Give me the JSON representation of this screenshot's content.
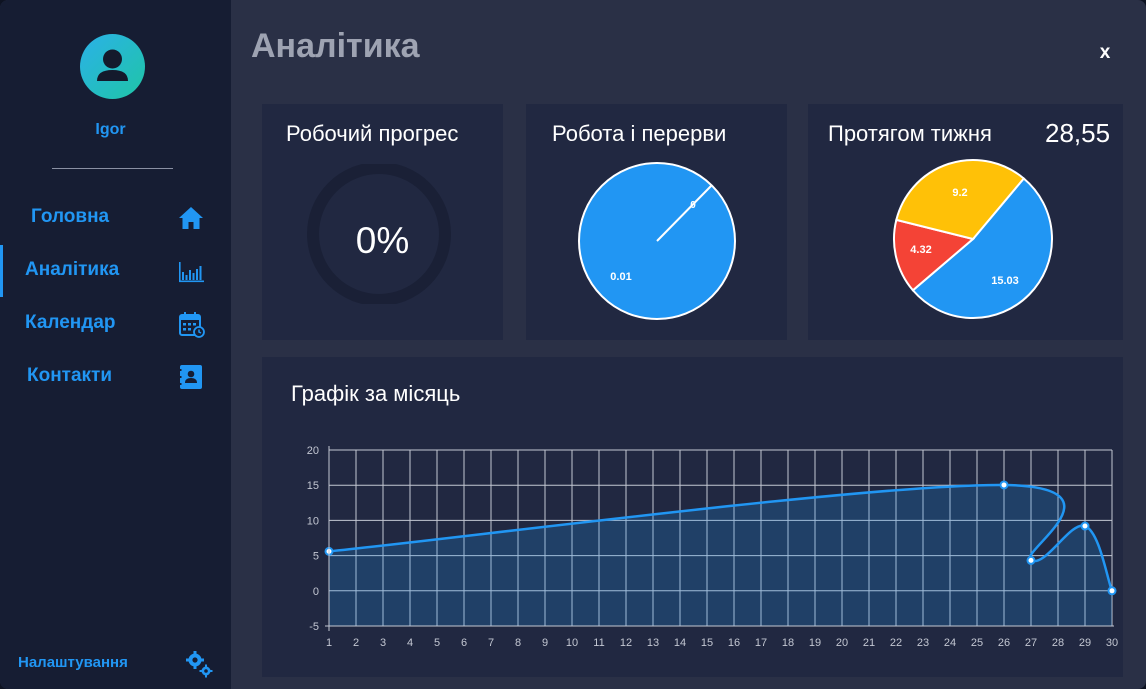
{
  "user": {
    "name": "Igor"
  },
  "nav": [
    {
      "label": "Головна",
      "icon": "home-icon",
      "active": false
    },
    {
      "label": "Аналітика",
      "icon": "bar-chart-icon",
      "active": true
    },
    {
      "label": "Календар",
      "icon": "calendar-icon",
      "active": false
    },
    {
      "label": "Контакти",
      "icon": "contact-book-icon",
      "active": false
    }
  ],
  "settings": {
    "label": "Налаштування",
    "icon": "gears-icon"
  },
  "header": {
    "title": "Аналітика",
    "close_label": "x"
  },
  "cards": {
    "progress": {
      "title": "Робочий прогрес",
      "value": "0%"
    },
    "work_breaks": {
      "title": "Робота і перерви"
    },
    "week": {
      "title": "Протягом тижня",
      "total": "28,55"
    },
    "month": {
      "title": "Графік за місяць"
    }
  },
  "colors": {
    "accent": "#2196f3",
    "red": "#f44336",
    "yellow": "#ffc107",
    "panel": "#212841",
    "background": "#2a3046",
    "sidebar": "#161d33"
  },
  "chart_data": [
    {
      "type": "pie",
      "title": "Робота і перерви",
      "slices": [
        {
          "label": "0.01",
          "value": 0.01,
          "color": "#2196f3"
        },
        {
          "label": "0",
          "value": 0,
          "color": "#2196f3"
        }
      ]
    },
    {
      "type": "pie",
      "title": "Протягом тижня",
      "slices": [
        {
          "label": "15.03",
          "value": 15.03,
          "color": "#2196f3"
        },
        {
          "label": "4.32",
          "value": 4.32,
          "color": "#f44336"
        },
        {
          "label": "9.2",
          "value": 9.2,
          "color": "#ffc107"
        }
      ]
    },
    {
      "type": "area",
      "title": "Графік за місяць",
      "x": [
        1,
        2,
        3,
        4,
        5,
        6,
        7,
        8,
        9,
        10,
        11,
        12,
        13,
        14,
        15,
        16,
        17,
        18,
        19,
        20,
        21,
        22,
        23,
        24,
        25,
        26,
        27,
        28,
        29,
        30
      ],
      "points": [
        {
          "x": 1,
          "y": 5.6
        },
        {
          "x": 26,
          "y": 15.03
        },
        {
          "x": 27,
          "y": 4.32
        },
        {
          "x": 29,
          "y": 9.2
        },
        {
          "x": 30,
          "y": 0
        }
      ],
      "ylim": [
        -5,
        20
      ],
      "yticks": [
        20,
        15,
        10,
        5,
        0,
        -5
      ],
      "grid": true,
      "color": "#2196f3"
    }
  ]
}
